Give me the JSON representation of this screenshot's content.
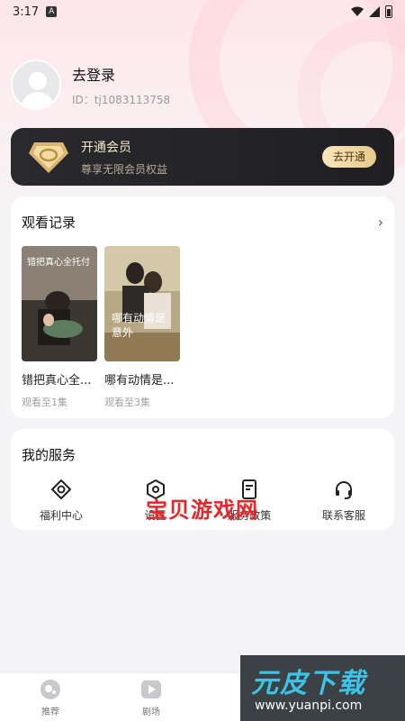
{
  "status_bar": {
    "time": "3:17",
    "notif_letter": "A"
  },
  "profile": {
    "title": "去登录",
    "user_id": "ID：tj1083113758"
  },
  "vip": {
    "title": "开通会员",
    "subtitle": "尊享无限会员权益",
    "button": "去开通"
  },
  "history": {
    "title": "观看记录",
    "items": [
      {
        "title": "错把真心全...",
        "progress": "观看至1集",
        "poster_text": "错把真心全托付"
      },
      {
        "title": "哪有动情是...",
        "progress": "观看至3集",
        "poster_text": "哪有动情是意外"
      }
    ]
  },
  "services": {
    "title": "我的服务",
    "items": [
      {
        "label": "福利中心",
        "icon": "target-icon"
      },
      {
        "label": "设置",
        "icon": "hexagon-settings-icon"
      },
      {
        "label": "服务政策",
        "icon": "document-icon"
      },
      {
        "label": "联系客服",
        "icon": "headset-icon"
      }
    ]
  },
  "watermark": "宝贝游戏网",
  "bottom_nav": {
    "items": [
      {
        "label": "推荐"
      },
      {
        "label": "剧场"
      }
    ]
  },
  "logo": {
    "main": "元皮下载",
    "url": "www.yuanpi.com"
  },
  "colors": {
    "accent_red": "#e8262a",
    "vip_gold": "#e8c98a",
    "logo_blue": "#3cc3e6"
  }
}
